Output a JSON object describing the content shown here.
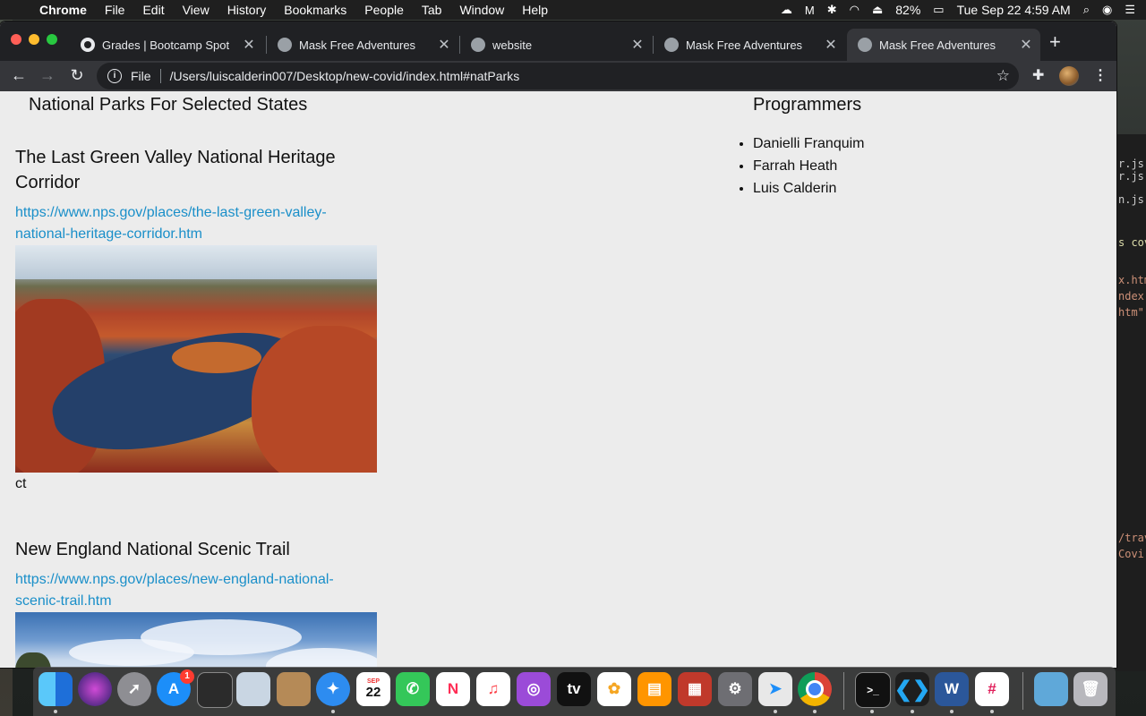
{
  "menubar": {
    "app": "Chrome",
    "menus": [
      "File",
      "Edit",
      "View",
      "History",
      "Bookmarks",
      "People",
      "Tab",
      "Window",
      "Help"
    ],
    "battery": "82%",
    "clock": "Tue Sep 22  4:59 AM"
  },
  "tabs": [
    {
      "title": "Grades | Bootcamp Spot"
    },
    {
      "title": "Mask Free Adventures"
    },
    {
      "title": "website"
    },
    {
      "title": "Mask Free Adventures"
    },
    {
      "title": "Mask Free Adventures"
    }
  ],
  "toolbar": {
    "scheme_label": "File",
    "url": "/Users/luiscalderin007/Desktop/new-covid/index.html#natParks"
  },
  "page": {
    "parks_heading": "National Parks For Selected States",
    "programmers_heading": "Programmers",
    "programmers": [
      "Danielli Franquim",
      "Farrah Heath",
      "Luis Calderin"
    ],
    "parks": [
      {
        "name": "The Last Green Valley National Heritage Corridor",
        "url": "https://www.nps.gov/places/the-last-green-valley-national-heritage-corridor.htm",
        "state": "ct"
      },
      {
        "name": "New England National Scenic Trail",
        "url": "https://www.nps.gov/places/new-england-national-scenic-trail.htm"
      }
    ]
  },
  "background_editor": {
    "lines": [
      "r.js",
      "r.js.",
      "n.js",
      "s cov",
      "x.htm",
      "ndex.",
      "htm\"",
      "/trav",
      "Covi"
    ]
  },
  "dock": {
    "app_store_badge": "1",
    "calendar_month": "SEP",
    "calendar_day": "22"
  }
}
